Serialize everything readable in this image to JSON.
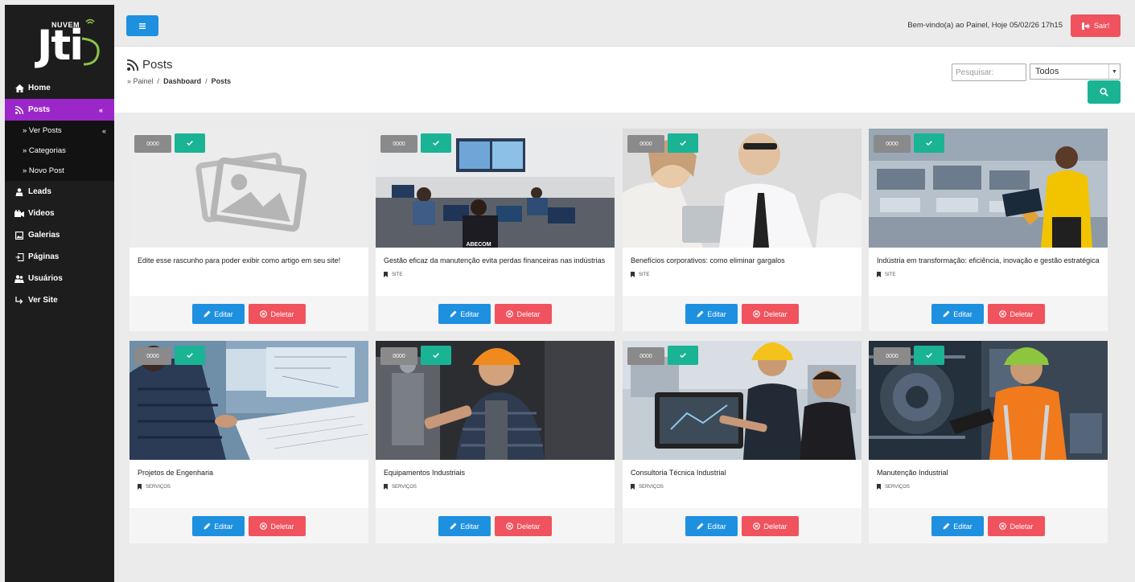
{
  "brand": {
    "logo_text": "Jti",
    "logo_sub": "NUVEM"
  },
  "sidebar": {
    "items": [
      {
        "label": "Home",
        "icon": "home-icon"
      },
      {
        "label": "Posts",
        "icon": "rss-icon",
        "chevron": "«",
        "active": true
      },
      {
        "label": "Leads",
        "icon": "user-icon"
      },
      {
        "label": "Videos",
        "icon": "video-icon"
      },
      {
        "label": "Galerias",
        "icon": "image-icon"
      },
      {
        "label": "Páginas",
        "icon": "pages-icon"
      },
      {
        "label": "Usuários",
        "icon": "users-icon"
      },
      {
        "label": "Ver Site",
        "icon": "share-icon"
      }
    ],
    "subitems": [
      {
        "label": "» Ver Posts",
        "chevron": "«"
      },
      {
        "label": "» Categorias"
      },
      {
        "label": "» Novo Post"
      }
    ]
  },
  "topbar": {
    "welcome": "Bem-vindo(a) ao Painel, Hoje 05/02/26 17h15",
    "logout_label": "Sair!"
  },
  "header": {
    "title": "Posts",
    "breadcrumb": {
      "prefix": "» Painel",
      "sep": "/",
      "dashboard": "Dashboard",
      "current": "Posts"
    },
    "search_placeholder": "Pesquisar:",
    "filter_value": "Todos"
  },
  "colors": {
    "primary": "#1e90e0",
    "danger": "#f0525e",
    "success": "#1ab394",
    "accent": "#9b27c9",
    "sidebar": "#1d1d1d"
  },
  "posts": [
    {
      "views": "0000",
      "title": "Edite esse rascunho para poder exibir como artigo em seu site!",
      "category": "",
      "image": "placeholder"
    },
    {
      "views": "0000",
      "title": "Gestão eficaz da manutenção evita perdas financeiras nas indústrias",
      "category": "SITE",
      "image": "control-room"
    },
    {
      "views": "0000",
      "title": "Benefícios corporativos: como eliminar gargalos",
      "category": "SITE",
      "image": "office"
    },
    {
      "views": "0000",
      "title": "Indústria em transformação: eficiência, inovação e gestão estratégica",
      "category": "SITE",
      "image": "factory"
    },
    {
      "views": "0000",
      "title": "Projetos de Engenharia",
      "category": "SERVIÇOS",
      "image": "engineering"
    },
    {
      "views": "0000",
      "title": "Equipamentos Industriais",
      "category": "SERVIÇOS",
      "image": "machinist"
    },
    {
      "views": "0000",
      "title": "Consultoria Técnica Industrial",
      "category": "SERVIÇOS",
      "image": "consulting"
    },
    {
      "views": "0000",
      "title": "Manutenção Industrial",
      "category": "SERVIÇOS",
      "image": "maintenance"
    }
  ],
  "actions": {
    "edit_label": "Editar",
    "delete_label": "Deletar"
  }
}
